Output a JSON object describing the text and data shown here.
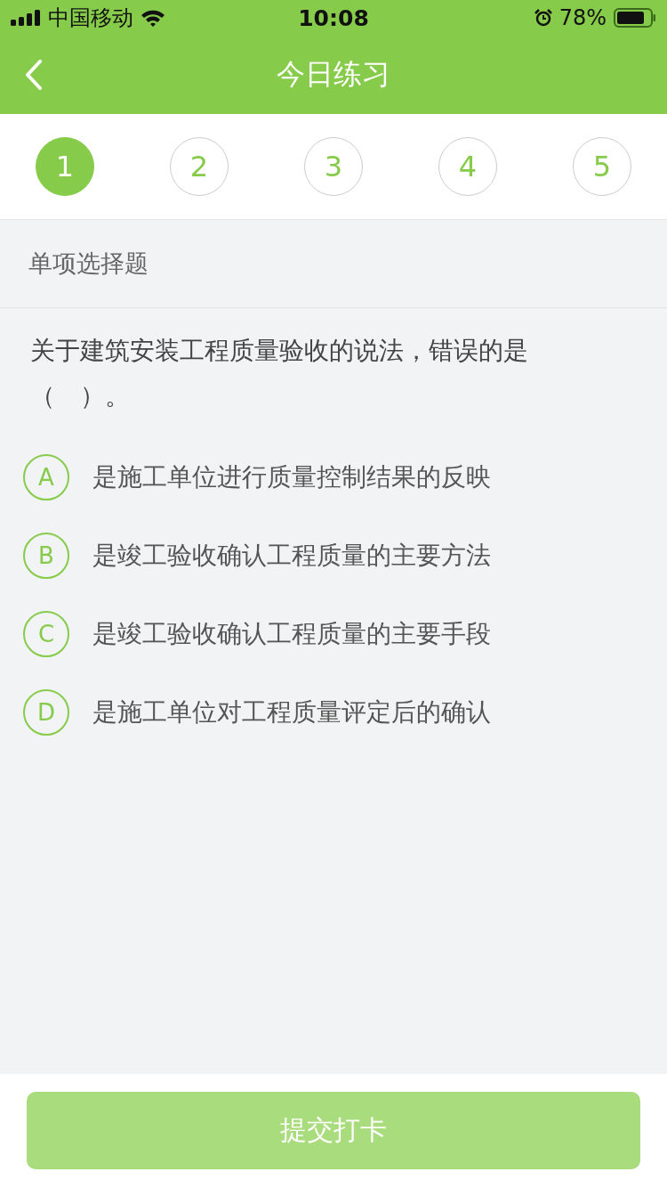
{
  "status_bar": {
    "carrier": "中国移动",
    "time": "10:08",
    "battery": "78%"
  },
  "nav": {
    "title": "今日练习"
  },
  "steps": [
    {
      "label": "1",
      "selected": true
    },
    {
      "label": "2",
      "selected": false
    },
    {
      "label": "3",
      "selected": false
    },
    {
      "label": "4",
      "selected": false
    },
    {
      "label": "5",
      "selected": false
    }
  ],
  "section": {
    "title": "单项选择题"
  },
  "question": {
    "text": "关于建筑安装工程质量验收的说法，错误的是（　）。",
    "options": [
      {
        "letter": "A",
        "text": "是施工单位进行质量控制结果的反映",
        "selected": false
      },
      {
        "letter": "B",
        "text": "是竣工验收确认工程质量的主要方法",
        "selected": false
      },
      {
        "letter": "C",
        "text": "是竣工验收确认工程质量的主要手段",
        "selected": false
      },
      {
        "letter": "D",
        "text": "是施工单位对工程质量评定后的确认",
        "selected": false
      }
    ]
  },
  "submit": {
    "label": "提交打卡",
    "disabled": true
  }
}
